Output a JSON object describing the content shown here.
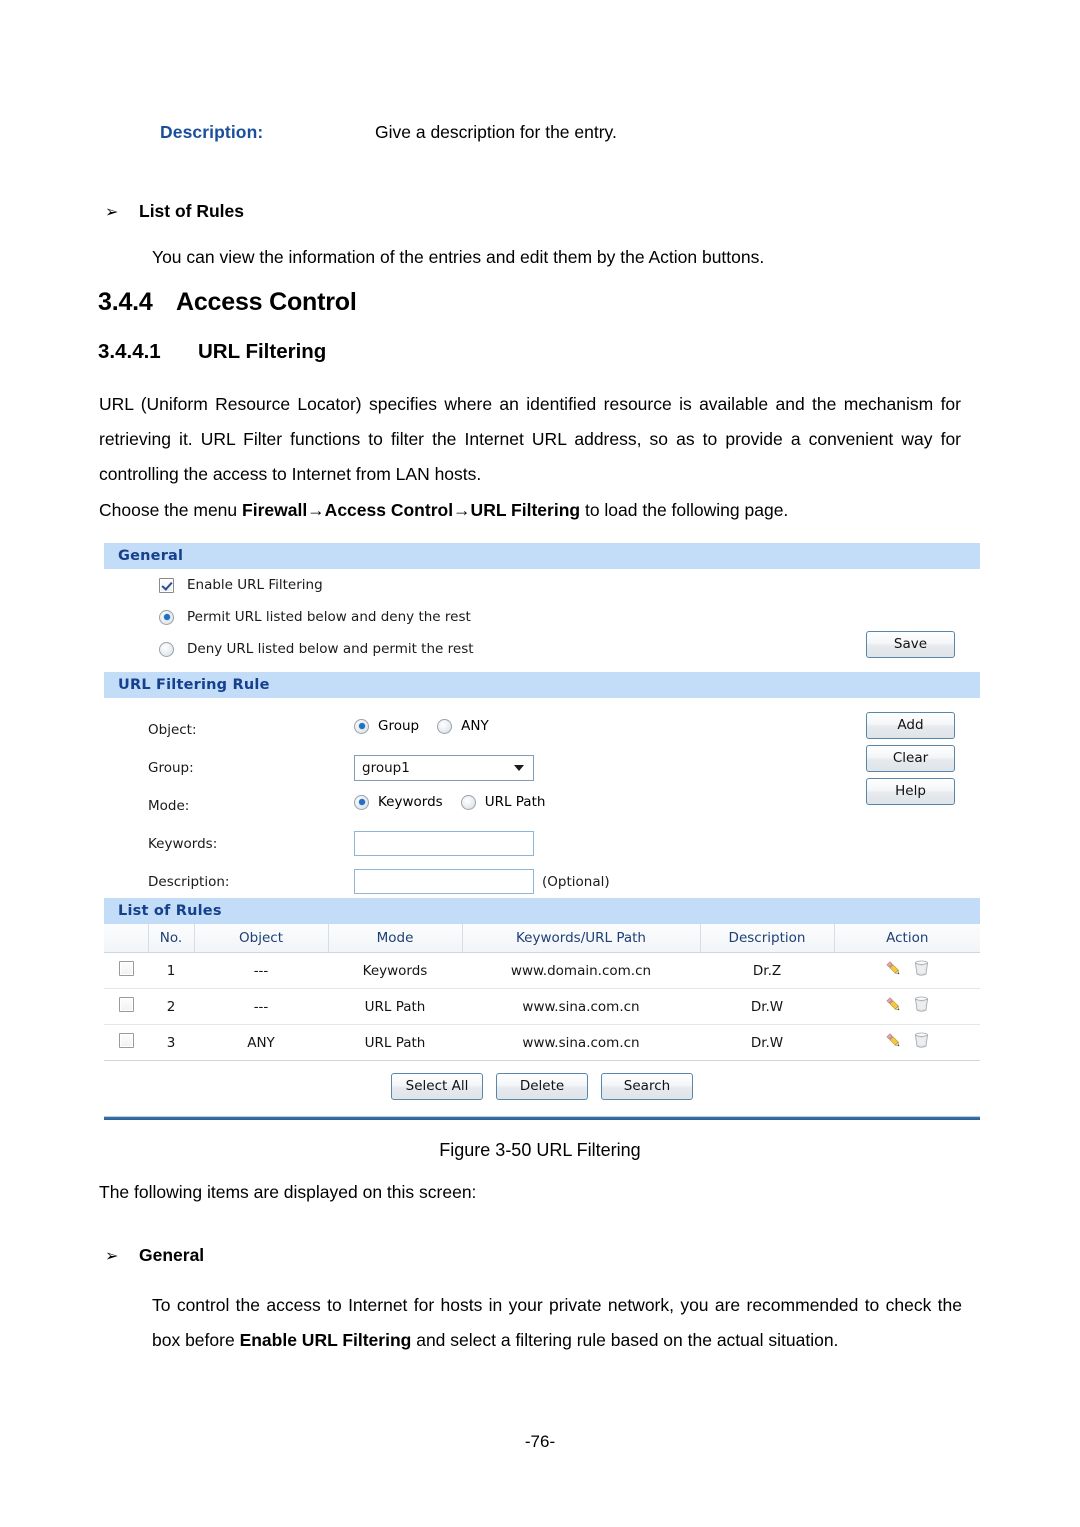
{
  "document": {
    "description_row": {
      "term": "Description:",
      "definition": "Give a description for the entry."
    },
    "bullet_rules": {
      "arrow": "➢",
      "label": "List of Rules"
    },
    "para_rules": "You can view the information of the entries and edit them by the Action buttons.",
    "section": {
      "number": "3.4.4",
      "title": "Access Control"
    },
    "subsection": {
      "number": "3.4.4.1",
      "title": "URL Filtering"
    },
    "para_url": "URL (Uniform Resource Locator) specifies where an identified resource is available and the mechanism for retrieving it. URL Filter functions to filter the Internet URL address, so as to provide a convenient way for controlling the access to Internet from LAN hosts.",
    "para_choose": {
      "prefix": "Choose the menu ",
      "menu_path": "Firewall→Access Control→URL Filtering",
      "suffix": " to load the following page."
    },
    "figure_caption": "Figure 3-50 URL Filtering",
    "para_following": "The following items are displayed on this screen:",
    "bullet_general": {
      "arrow": "➢",
      "label": "General"
    },
    "para_control": {
      "prefix": "To control the access to Internet for hosts in your private network, you are recommended to check the box before ",
      "bold": "Enable URL Filtering",
      "suffix": " and select a filtering rule based on the actual situation."
    },
    "page_number": "-76-"
  },
  "ui": {
    "general": {
      "header": "General",
      "enable_checkbox_label": "Enable URL Filtering",
      "enable_checkbox_checked": true,
      "radio_permit_label": "Permit URL listed below and deny the rest",
      "radio_deny_label": "Deny URL listed below and permit the rest",
      "selected_rule": "permit",
      "save_button": "Save"
    },
    "rule": {
      "header": "URL Filtering Rule",
      "object_label": "Object:",
      "object_option_group": "Group",
      "object_option_any": "ANY",
      "object_selected": "Group",
      "group_label": "Group:",
      "group_value": "group1",
      "mode_label": "Mode:",
      "mode_option_keywords": "Keywords",
      "mode_option_urlpath": "URL Path",
      "mode_selected": "Keywords",
      "keywords_label": "Keywords:",
      "keywords_value": "",
      "keywords_placeholder": "",
      "description_label": "Description:",
      "description_value": "",
      "description_placeholder": "",
      "optional_note": "(Optional)",
      "add_button": "Add",
      "clear_button": "Clear",
      "help_button": "Help"
    },
    "list": {
      "header": "List of Rules",
      "columns": [
        "",
        "No.",
        "Object",
        "Mode",
        "Keywords/URL Path",
        "Description",
        "Action"
      ],
      "rows": [
        {
          "checked": false,
          "no": "1",
          "object": "---",
          "mode": "Keywords",
          "keywords": "www.domain.com.cn",
          "description": "Dr.Z",
          "actions": [
            "edit-pencil-icon",
            "delete-trash-icon"
          ]
        },
        {
          "checked": false,
          "no": "2",
          "object": "---",
          "mode": "URL Path",
          "keywords": "www.sina.com.cn",
          "description": "Dr.W",
          "actions": [
            "edit-pencil-icon",
            "delete-trash-icon"
          ]
        },
        {
          "checked": false,
          "no": "3",
          "object": "ANY",
          "mode": "URL Path",
          "keywords": "www.sina.com.cn",
          "description": "Dr.W",
          "actions": [
            "edit-pencil-icon",
            "delete-trash-icon"
          ]
        }
      ],
      "select_all_button": "Select All",
      "delete_button": "Delete",
      "search_button": "Search"
    },
    "colors": {
      "section_header_bg": "#c3dcf7",
      "section_header_text": "#15418c",
      "accent_blue": "#1a4f9c",
      "table_header_text": "#1d3f77",
      "button_border": "#5a86ab",
      "divider": "#3c74ab"
    }
  }
}
